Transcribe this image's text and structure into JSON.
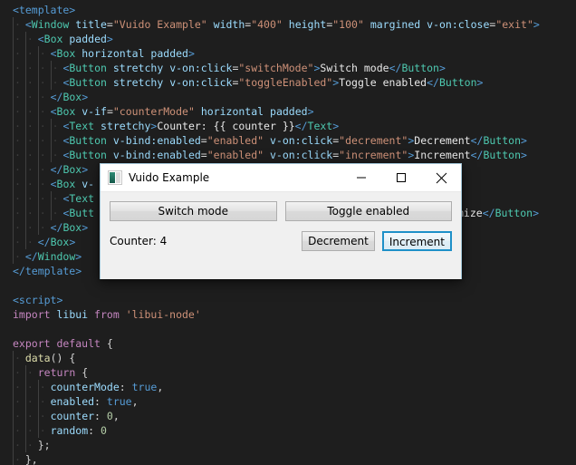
{
  "editor": {
    "background": "#1e1e1e",
    "lines": [
      {
        "indent": 0,
        "guides": 0,
        "tokens": [
          {
            "c": "t-tag",
            "t": "<template>"
          }
        ]
      },
      {
        "indent": 1,
        "guides": 1,
        "tokens": [
          {
            "c": "t-tag",
            "t": "<"
          },
          {
            "c": "t-tagname",
            "t": "Window"
          },
          {
            "c": "t-attrb",
            "t": " "
          },
          {
            "c": "t-attr",
            "t": "title"
          },
          {
            "c": "t-attrb",
            "t": "="
          },
          {
            "c": "t-str",
            "t": "\"Vuido Example\""
          },
          {
            "c": "t-attrb",
            "t": " "
          },
          {
            "c": "t-attr",
            "t": "width"
          },
          {
            "c": "t-attrb",
            "t": "="
          },
          {
            "c": "t-str",
            "t": "\"400\""
          },
          {
            "c": "t-attrb",
            "t": " "
          },
          {
            "c": "t-attr",
            "t": "height"
          },
          {
            "c": "t-attrb",
            "t": "="
          },
          {
            "c": "t-str",
            "t": "\"100\""
          },
          {
            "c": "t-attrb",
            "t": " "
          },
          {
            "c": "t-attr",
            "t": "margined"
          },
          {
            "c": "t-attrb",
            "t": " "
          },
          {
            "c": "t-attr",
            "t": "v-on:close"
          },
          {
            "c": "t-attrb",
            "t": "="
          },
          {
            "c": "t-str",
            "t": "\"exit\""
          },
          {
            "c": "t-tag",
            "t": ">"
          }
        ]
      },
      {
        "indent": 2,
        "guides": 2,
        "tokens": [
          {
            "c": "t-tag",
            "t": "<"
          },
          {
            "c": "t-tagname",
            "t": "Box"
          },
          {
            "c": "t-attrb",
            "t": " "
          },
          {
            "c": "t-attr",
            "t": "padded"
          },
          {
            "c": "t-tag",
            "t": ">"
          }
        ]
      },
      {
        "indent": 3,
        "guides": 3,
        "tokens": [
          {
            "c": "t-tag",
            "t": "<"
          },
          {
            "c": "t-tagname",
            "t": "Box"
          },
          {
            "c": "t-attrb",
            "t": " "
          },
          {
            "c": "t-attr",
            "t": "horizontal"
          },
          {
            "c": "t-attrb",
            "t": " "
          },
          {
            "c": "t-attr",
            "t": "padded"
          },
          {
            "c": "t-tag",
            "t": ">"
          }
        ]
      },
      {
        "indent": 4,
        "guides": 4,
        "tokens": [
          {
            "c": "t-tag",
            "t": "<"
          },
          {
            "c": "t-tagname",
            "t": "Button"
          },
          {
            "c": "t-attrb",
            "t": " "
          },
          {
            "c": "t-attr",
            "t": "stretchy"
          },
          {
            "c": "t-attrb",
            "t": " "
          },
          {
            "c": "t-attr",
            "t": "v-on:click"
          },
          {
            "c": "t-attrb",
            "t": "="
          },
          {
            "c": "t-str",
            "t": "\"switchMode\""
          },
          {
            "c": "t-tag",
            "t": ">"
          },
          {
            "c": "t-text",
            "t": "Switch mode"
          },
          {
            "c": "t-tag",
            "t": "</"
          },
          {
            "c": "t-tagname",
            "t": "Button"
          },
          {
            "c": "t-tag",
            "t": ">"
          }
        ]
      },
      {
        "indent": 4,
        "guides": 4,
        "tokens": [
          {
            "c": "t-tag",
            "t": "<"
          },
          {
            "c": "t-tagname",
            "t": "Button"
          },
          {
            "c": "t-attrb",
            "t": " "
          },
          {
            "c": "t-attr",
            "t": "stretchy"
          },
          {
            "c": "t-attrb",
            "t": " "
          },
          {
            "c": "t-attr",
            "t": "v-on:click"
          },
          {
            "c": "t-attrb",
            "t": "="
          },
          {
            "c": "t-str",
            "t": "\"toggleEnabled\""
          },
          {
            "c": "t-tag",
            "t": ">"
          },
          {
            "c": "t-text",
            "t": "Toggle enabled"
          },
          {
            "c": "t-tag",
            "t": "</"
          },
          {
            "c": "t-tagname",
            "t": "Button"
          },
          {
            "c": "t-tag",
            "t": ">"
          }
        ]
      },
      {
        "indent": 3,
        "guides": 3,
        "tokens": [
          {
            "c": "t-tag",
            "t": "</"
          },
          {
            "c": "t-tagname",
            "t": "Box"
          },
          {
            "c": "t-tag",
            "t": ">"
          }
        ]
      },
      {
        "indent": 3,
        "guides": 3,
        "tokens": [
          {
            "c": "t-tag",
            "t": "<"
          },
          {
            "c": "t-tagname",
            "t": "Box"
          },
          {
            "c": "t-attrb",
            "t": " "
          },
          {
            "c": "t-attr",
            "t": "v-if"
          },
          {
            "c": "t-attrb",
            "t": "="
          },
          {
            "c": "t-str",
            "t": "\"counterMode\""
          },
          {
            "c": "t-attrb",
            "t": " "
          },
          {
            "c": "t-attr",
            "t": "horizontal"
          },
          {
            "c": "t-attrb",
            "t": " "
          },
          {
            "c": "t-attr",
            "t": "padded"
          },
          {
            "c": "t-tag",
            "t": ">"
          }
        ]
      },
      {
        "indent": 4,
        "guides": 4,
        "tokens": [
          {
            "c": "t-tag",
            "t": "<"
          },
          {
            "c": "t-tagname",
            "t": "Text"
          },
          {
            "c": "t-attrb",
            "t": " "
          },
          {
            "c": "t-attr",
            "t": "stretchy"
          },
          {
            "c": "t-tag",
            "t": ">"
          },
          {
            "c": "t-text",
            "t": "Counter: {{ counter }}"
          },
          {
            "c": "t-tag",
            "t": "</"
          },
          {
            "c": "t-tagname",
            "t": "Text"
          },
          {
            "c": "t-tag",
            "t": ">"
          }
        ]
      },
      {
        "indent": 4,
        "guides": 4,
        "tokens": [
          {
            "c": "t-tag",
            "t": "<"
          },
          {
            "c": "t-tagname",
            "t": "Button"
          },
          {
            "c": "t-attrb",
            "t": " "
          },
          {
            "c": "t-attr",
            "t": "v-bind:enabled"
          },
          {
            "c": "t-attrb",
            "t": "="
          },
          {
            "c": "t-str",
            "t": "\"enabled\""
          },
          {
            "c": "t-attrb",
            "t": " "
          },
          {
            "c": "t-attr",
            "t": "v-on:click"
          },
          {
            "c": "t-attrb",
            "t": "="
          },
          {
            "c": "t-str",
            "t": "\"decrement\""
          },
          {
            "c": "t-tag",
            "t": ">"
          },
          {
            "c": "t-text",
            "t": "Decrement"
          },
          {
            "c": "t-tag",
            "t": "</"
          },
          {
            "c": "t-tagname",
            "t": "Button"
          },
          {
            "c": "t-tag",
            "t": ">"
          }
        ]
      },
      {
        "indent": 4,
        "guides": 4,
        "tokens": [
          {
            "c": "t-tag",
            "t": "<"
          },
          {
            "c": "t-tagname",
            "t": "Button"
          },
          {
            "c": "t-attrb",
            "t": " "
          },
          {
            "c": "t-attr",
            "t": "v-bind:enabled"
          },
          {
            "c": "t-attrb",
            "t": "="
          },
          {
            "c": "t-str",
            "t": "\"enabled\""
          },
          {
            "c": "t-attrb",
            "t": " "
          },
          {
            "c": "t-attr",
            "t": "v-on:click"
          },
          {
            "c": "t-attrb",
            "t": "="
          },
          {
            "c": "t-str",
            "t": "\"increment\""
          },
          {
            "c": "t-tag",
            "t": ">"
          },
          {
            "c": "t-text",
            "t": "Increment"
          },
          {
            "c": "t-tag",
            "t": "</"
          },
          {
            "c": "t-tagname",
            "t": "Button"
          },
          {
            "c": "t-tag",
            "t": ">"
          }
        ]
      },
      {
        "indent": 3,
        "guides": 3,
        "tokens": [
          {
            "c": "t-tag",
            "t": "</"
          },
          {
            "c": "t-tagname",
            "t": "Box"
          },
          {
            "c": "t-tag",
            "t": ">"
          }
        ]
      },
      {
        "indent": 3,
        "guides": 3,
        "tokens": [
          {
            "c": "t-tag",
            "t": "<"
          },
          {
            "c": "t-tagname",
            "t": "Box"
          },
          {
            "c": "t-attrb",
            "t": " "
          },
          {
            "c": "t-attr",
            "t": "v-"
          }
        ]
      },
      {
        "indent": 4,
        "guides": 4,
        "tokens": [
          {
            "c": "t-tag",
            "t": "<"
          },
          {
            "c": "t-tagname",
            "t": "Text"
          }
        ]
      },
      {
        "indent": 4,
        "guides": 4,
        "tokens": [
          {
            "c": "t-tag",
            "t": "<"
          },
          {
            "c": "t-tagname",
            "t": "Butt"
          }
        ]
      },
      {
        "indent": 3,
        "guides": 3,
        "tokens": [
          {
            "c": "t-tag",
            "t": "</"
          },
          {
            "c": "t-tagname",
            "t": "Box"
          },
          {
            "c": "t-tag",
            "t": ">"
          }
        ]
      },
      {
        "indent": 2,
        "guides": 2,
        "tokens": [
          {
            "c": "t-tag",
            "t": "</"
          },
          {
            "c": "t-tagname",
            "t": "Box"
          },
          {
            "c": "t-tag",
            "t": ">"
          }
        ]
      },
      {
        "indent": 1,
        "guides": 1,
        "tokens": [
          {
            "c": "t-tag",
            "t": "</"
          },
          {
            "c": "t-tagname",
            "t": "Window"
          },
          {
            "c": "t-tag",
            "t": ">"
          }
        ]
      },
      {
        "indent": 0,
        "guides": 0,
        "tokens": [
          {
            "c": "t-tag",
            "t": "</template>"
          }
        ]
      },
      {
        "indent": 0,
        "guides": 0,
        "tokens": []
      },
      {
        "indent": 0,
        "guides": 0,
        "tokens": [
          {
            "c": "t-tag",
            "t": "<script>"
          }
        ]
      },
      {
        "indent": 0,
        "guides": 0,
        "tokens": [
          {
            "c": "t-kw",
            "t": "import"
          },
          {
            "c": "t-plain",
            "t": " "
          },
          {
            "c": "t-id",
            "t": "libui"
          },
          {
            "c": "t-plain",
            "t": " "
          },
          {
            "c": "t-kw",
            "t": "from"
          },
          {
            "c": "t-plain",
            "t": " "
          },
          {
            "c": "t-str",
            "t": "'libui-node'"
          }
        ]
      },
      {
        "indent": 0,
        "guides": 0,
        "tokens": []
      },
      {
        "indent": 0,
        "guides": 0,
        "tokens": [
          {
            "c": "t-kw",
            "t": "export default"
          },
          {
            "c": "t-plain",
            "t": " {"
          }
        ]
      },
      {
        "indent": 1,
        "guides": 1,
        "tokens": [
          {
            "c": "t-fn",
            "t": "data"
          },
          {
            "c": "t-plain",
            "t": "() {"
          }
        ]
      },
      {
        "indent": 2,
        "guides": 2,
        "tokens": [
          {
            "c": "t-kw",
            "t": "return"
          },
          {
            "c": "t-plain",
            "t": " {"
          }
        ]
      },
      {
        "indent": 3,
        "guides": 3,
        "tokens": [
          {
            "c": "t-id",
            "t": "counterMode"
          },
          {
            "c": "t-plain",
            "t": ": "
          },
          {
            "c": "t-bool",
            "t": "true"
          },
          {
            "c": "t-plain",
            "t": ","
          }
        ]
      },
      {
        "indent": 3,
        "guides": 3,
        "tokens": [
          {
            "c": "t-id",
            "t": "enabled"
          },
          {
            "c": "t-plain",
            "t": ": "
          },
          {
            "c": "t-bool",
            "t": "true"
          },
          {
            "c": "t-plain",
            "t": ","
          }
        ]
      },
      {
        "indent": 3,
        "guides": 3,
        "tokens": [
          {
            "c": "t-id",
            "t": "counter"
          },
          {
            "c": "t-plain",
            "t": ": "
          },
          {
            "c": "t-num",
            "t": "0"
          },
          {
            "c": "t-plain",
            "t": ","
          }
        ]
      },
      {
        "indent": 3,
        "guides": 3,
        "tokens": [
          {
            "c": "t-id",
            "t": "random"
          },
          {
            "c": "t-plain",
            "t": ": "
          },
          {
            "c": "t-num",
            "t": "0"
          }
        ]
      },
      {
        "indent": 2,
        "guides": 2,
        "tokens": [
          {
            "c": "t-plain",
            "t": "};"
          }
        ]
      },
      {
        "indent": 1,
        "guides": 1,
        "tokens": [
          {
            "c": "t-plain",
            "t": "},"
          }
        ]
      }
    ],
    "occluded_fragment": {
      "text_before": "mize",
      "tokens": [
        {
          "c": "t-text",
          "t": "mize"
        },
        {
          "c": "t-tag",
          "t": "</"
        },
        {
          "c": "t-tagname",
          "t": "Button"
        },
        {
          "c": "t-tag",
          "t": ">"
        }
      ]
    }
  },
  "dialog": {
    "title": "Vuido Example",
    "icon": "app-window-icon",
    "titlebar_buttons": [
      {
        "name": "minimize",
        "glyph": "minimize-icon"
      },
      {
        "name": "maximize",
        "glyph": "maximize-icon"
      },
      {
        "name": "close",
        "glyph": "close-icon"
      }
    ],
    "buttons_row1": [
      {
        "label": "Switch mode"
      },
      {
        "label": "Toggle enabled"
      }
    ],
    "counter_label": "Counter: 4",
    "buttons_row2": [
      {
        "label": "Decrement",
        "focused": false
      },
      {
        "label": "Increment",
        "focused": true
      }
    ],
    "colors": {
      "chrome": "#f0f0f0",
      "titlebar": "#ffffff",
      "button_face": "#e3e3e3",
      "button_border": "#adadad",
      "focus_border": "#1e90c8"
    }
  }
}
